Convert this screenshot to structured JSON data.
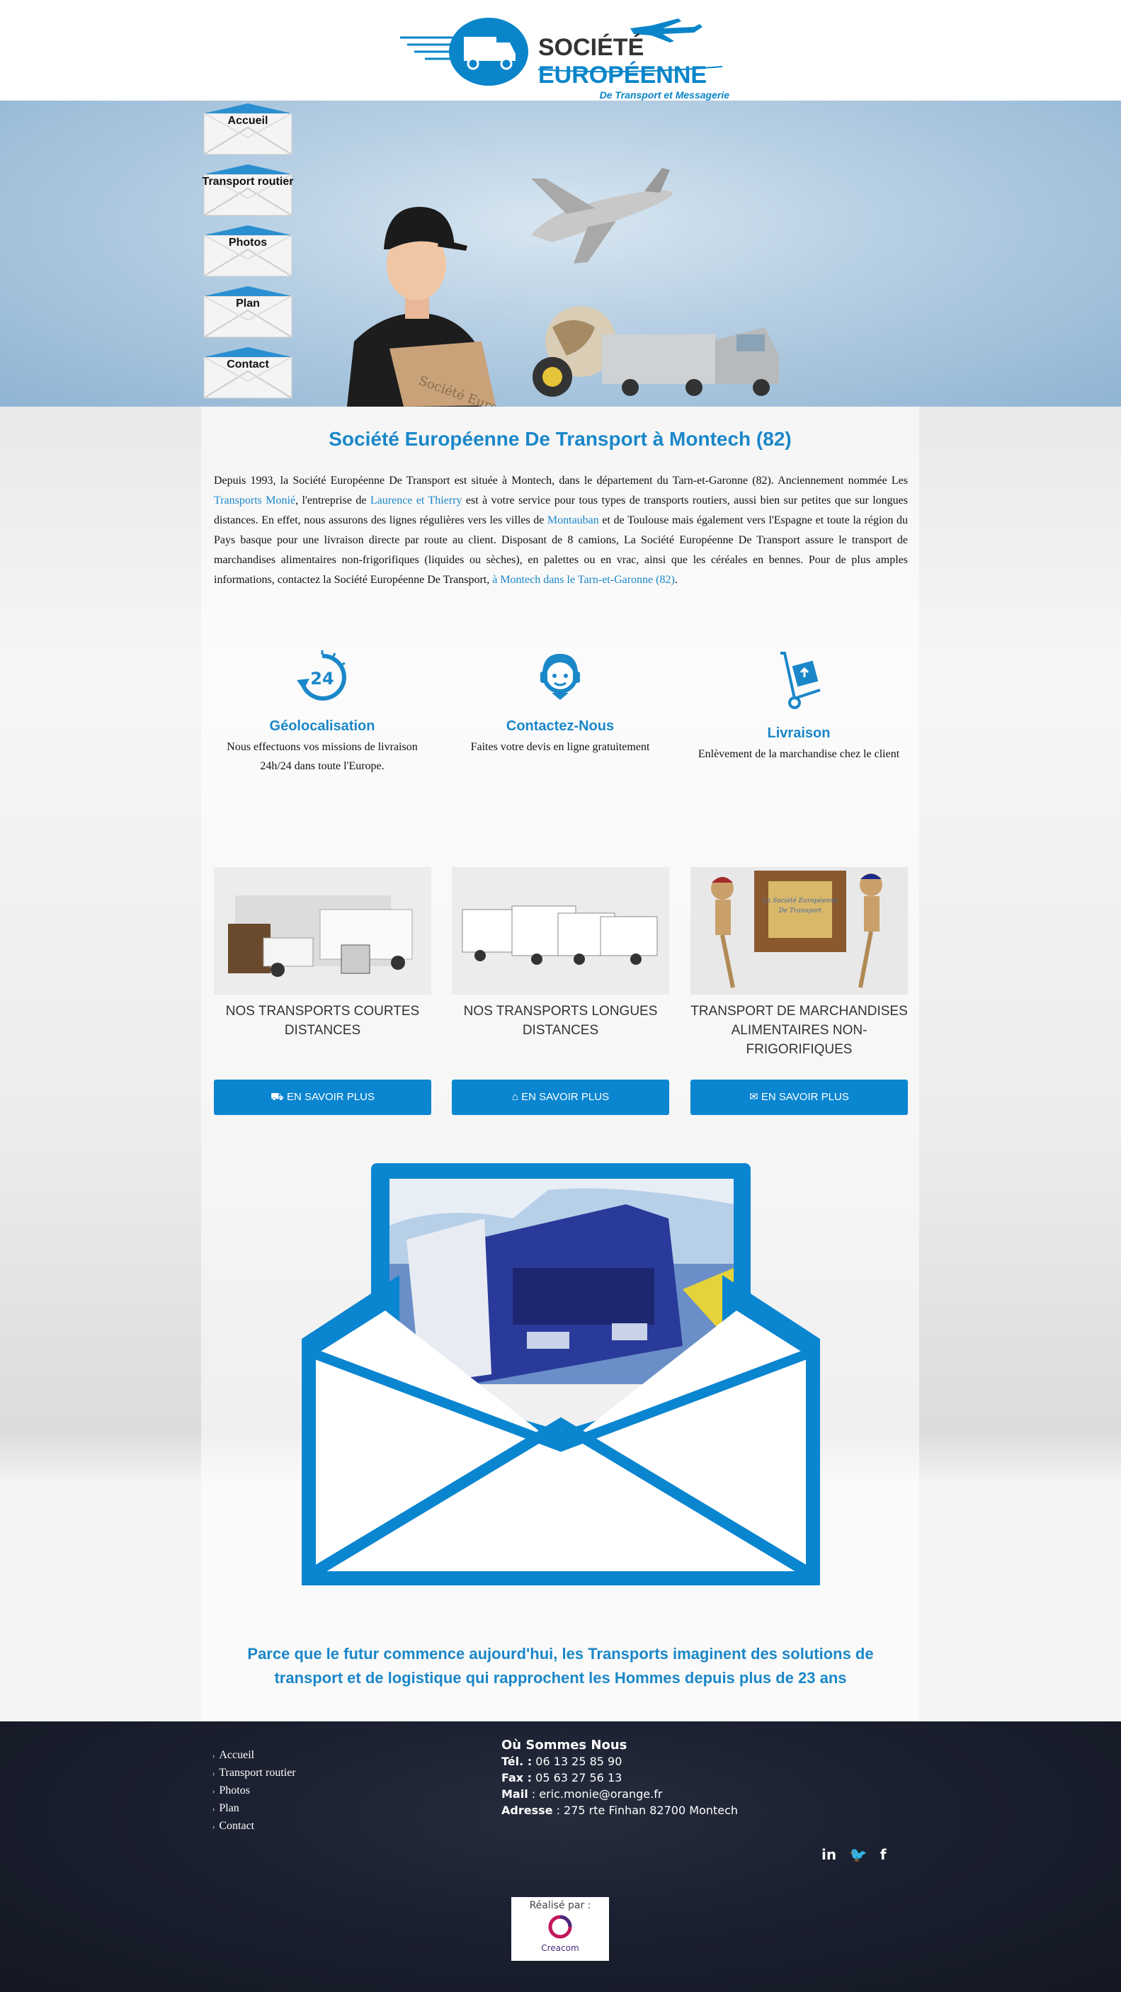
{
  "header": {
    "logo_line1_a": "SOCIÉTÉ ",
    "logo_line1_b": "EUROPÉENNE",
    "logo_line2": "De Transport et Messagerie"
  },
  "nav": {
    "items": [
      "Accueil",
      "Transport routier",
      "Photos",
      "Plan",
      "Contact"
    ]
  },
  "banner": {
    "box_text": "Société Européenne"
  },
  "main": {
    "title": "Société Européenne De Transport à Montech (82)",
    "intro": {
      "p1": "Depuis 1993, la Société Européenne De Transport est située à Montech, dans le département du Tarn-et-Garonne (82). Anciennement nommée Les ",
      "link1": "Transports Monié",
      "p2": ", l'entreprise de ",
      "link2": "Laurence et Thierry",
      "p3": " est à votre service pour tous types de transports routiers, aussi bien sur petites que sur longues distances. En effet, nous assurons des lignes régulières vers les villes de ",
      "link3": "Montauban",
      "p4": " et de Toulouse mais également vers l'Espagne et toute la région du Pays basque pour une livraison directe par route au client. Disposant de 8 camions, La Société Européenne De Transport assure le transport de marchandises alimentaires non-frigorifiques (liquides ou sèches), en palettes ou en vrac, ainsi que les céréales en bennes. Pour de plus amples informations, contactez la Société Européenne De Transport, ",
      "link4": "à Montech dans le Tarn-et-Garonne (82)",
      "p5": "."
    },
    "features": [
      {
        "icon_label": "24",
        "title": "Géolocalisation",
        "text": "Nous effectuons vos missions de livraison 24h/24 dans toute l'Europe."
      },
      {
        "title": "Contactez-Nous",
        "text": "Faites votre devis en ligne gratuitement"
      },
      {
        "title": "Livraison",
        "text": "Enlèvement de la marchandise chez le client"
      }
    ],
    "cards": [
      {
        "title": "NOS TRANSPORTS COURTES DISTANCES",
        "button": "⛟ EN SAVOIR PLUS"
      },
      {
        "title": "NOS TRANSPORTS LONGUES DISTANCES",
        "button": "⌂ EN SAVOIR PLUS"
      },
      {
        "title": "TRANSPORT DE MARCHANDISES ALIMENTAIRES NON-FRIGORIFIQUES",
        "button": "✉ EN SAVOIR PLUS",
        "image_text_1": "La Société Européenne",
        "image_text_2": "De Transport"
      }
    ],
    "tagline": "Parce que le futur commence aujourd'hui, les Transports  imaginent des solutions de transport et de logistique qui rapprochent les Hommes depuis plus de 23 ans"
  },
  "footer": {
    "links": [
      "Accueil",
      "Transport routier",
      "Photos",
      "Plan",
      "Contact"
    ],
    "contact_title": "Où Sommes Nous",
    "tel_label": "Tél. :",
    "tel": " 06 13 25 85 90",
    "fax_label": "Fax :",
    "fax": " 05 63 27 56 13",
    "mail_label": "Mail",
    "mail": " : eric.monie@orange.fr",
    "address_label": "Adresse",
    "address": " : 275 rte Finhan 82700 Montech",
    "social": [
      "in",
      "🐦",
      "f"
    ],
    "credit_label": "Réalisé par :",
    "credit_name": "Creacom"
  },
  "colors": {
    "accent": "#1a87c9",
    "button": "#0a85d0",
    "footer": "#1b2030"
  }
}
